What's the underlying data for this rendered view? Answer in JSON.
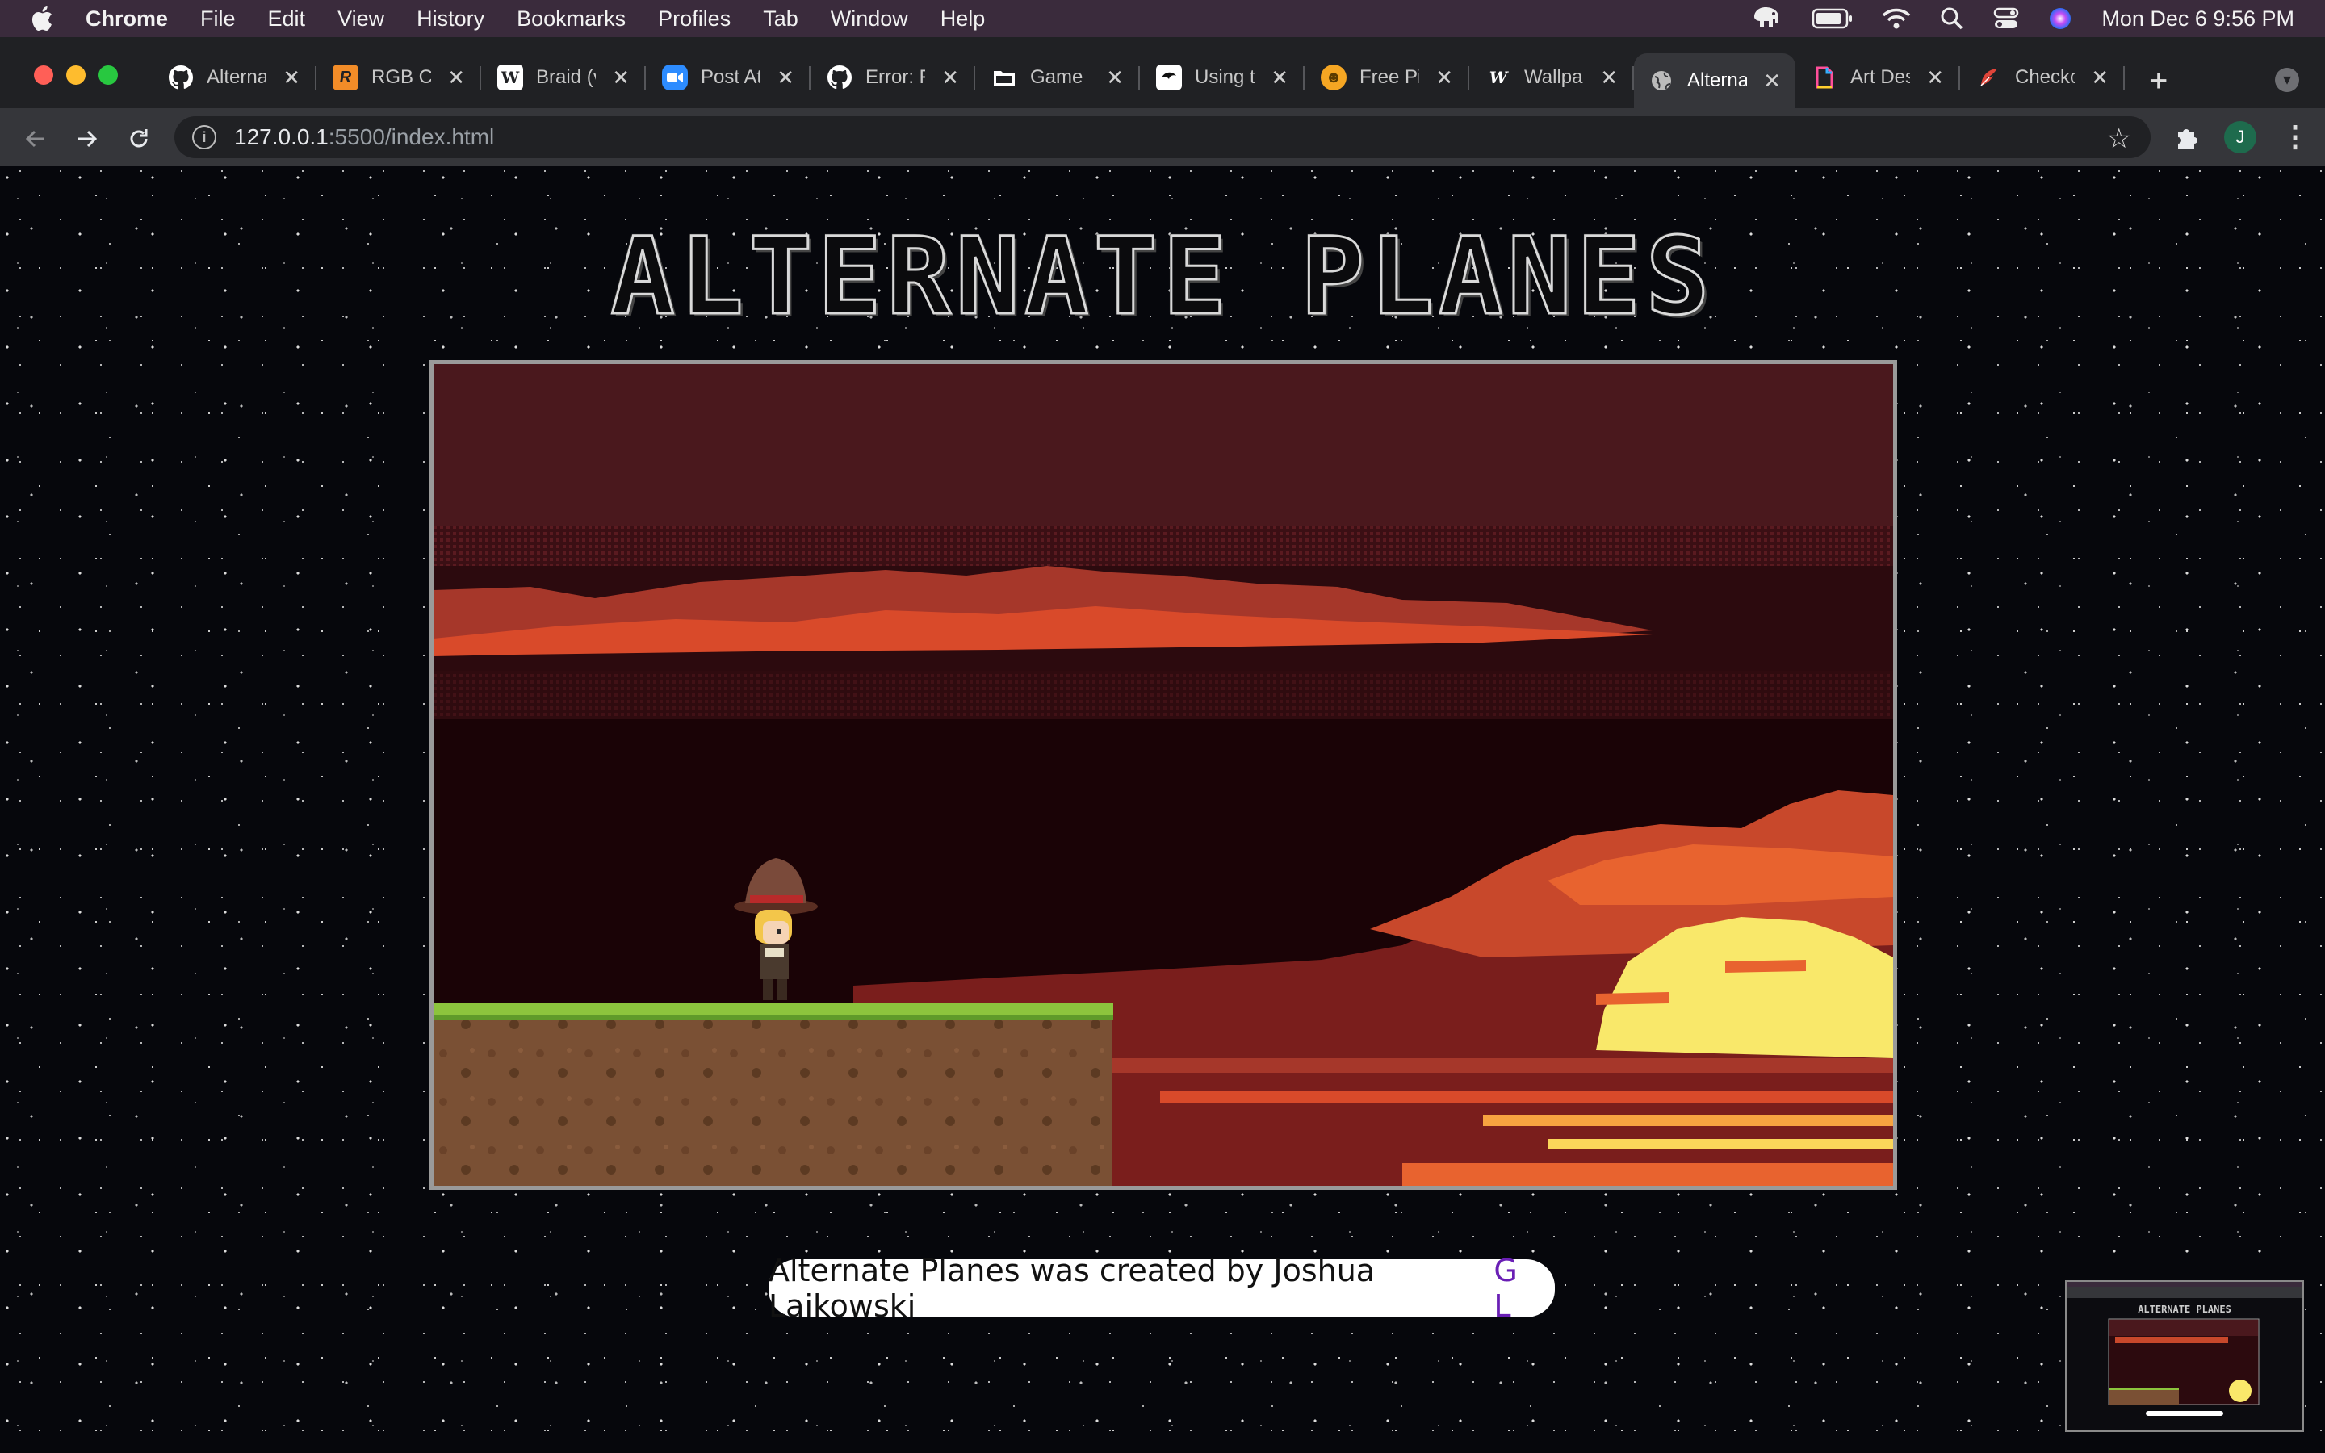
{
  "menubar": {
    "app_name": "Chrome",
    "items": [
      "File",
      "Edit",
      "View",
      "History",
      "Bookmarks",
      "Profiles",
      "Tab",
      "Window",
      "Help"
    ],
    "clock": "Mon Dec 6  9:56 PM"
  },
  "tabs": [
    {
      "label": "Alternate Planes",
      "icon": "github-icon",
      "color": "#ffffff"
    },
    {
      "label": "RGB Color",
      "icon": "r-logo-icon",
      "color": "#f28c28"
    },
    {
      "label": "Braid (video game)",
      "icon": "wikipedia-icon",
      "color": "#ffffff"
    },
    {
      "label": "Post Attendee",
      "icon": "zoom-icon",
      "color": "#2d8cff"
    },
    {
      "label": "Error: Failed",
      "icon": "github-icon",
      "color": "#ffffff"
    },
    {
      "label": "Game",
      "icon": "folder-icon",
      "color": "#ffffff"
    },
    {
      "label": "Using the",
      "icon": "brand-icon",
      "color": "#ffffff"
    },
    {
      "label": "Free Pixel",
      "icon": "itch-icon",
      "color": "#f5a623"
    },
    {
      "label": "Wallpaper",
      "icon": "w-icon",
      "color": "#ffffff"
    },
    {
      "label": "Alternate",
      "icon": "globe-icon",
      "color": "#bbbbbb",
      "active": true
    },
    {
      "label": "Art Design",
      "icon": "doc-icon",
      "color": "#ff4f9a"
    },
    {
      "label": "Checkout",
      "icon": "feather-icon",
      "color": "#e0453a"
    }
  ],
  "address": {
    "host": "127.0.0.1",
    "rest": ":5500/index.html"
  },
  "profile_initial": "J",
  "page": {
    "title": "ALTERNATE PLANES",
    "credit": "Alternate Planes was created by Joshua Laikowski",
    "credit_links": "G L"
  }
}
